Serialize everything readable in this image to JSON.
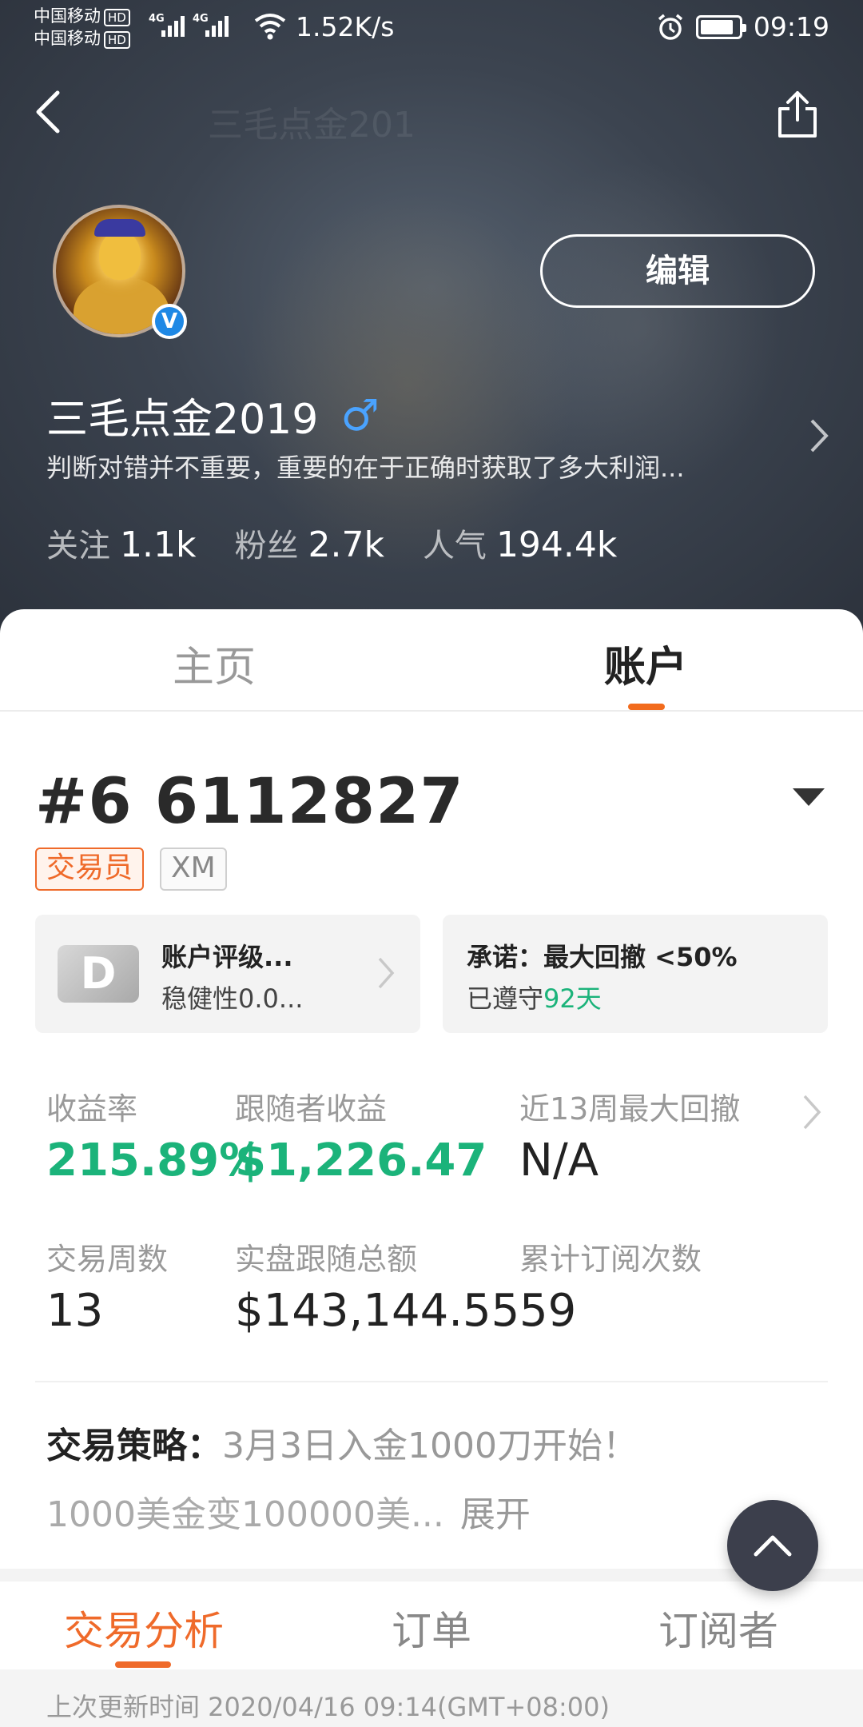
{
  "status_bar": {
    "carrier_1": "中国移动",
    "carrier_2": "中国移动",
    "hd_label": "HD",
    "network_type": "4G",
    "net_speed": "1.52K/s",
    "time": "09:19"
  },
  "header": {
    "faded_title": "三毛点金201"
  },
  "profile": {
    "name": "三毛点金2019",
    "gender_symbol": "♂",
    "verified_mark": "V",
    "edit_label": "编辑",
    "bio": "判断对错并不重要，重要的在于正确时获取了多大利润...",
    "stats": [
      {
        "label": "关注",
        "value": "1.1k"
      },
      {
        "label": "粉丝",
        "value": "2.7k"
      },
      {
        "label": "人气",
        "value": "194.4k"
      }
    ]
  },
  "tabs": {
    "home": "主页",
    "account": "账户"
  },
  "account": {
    "number": "#6 6112827",
    "tag_trader": "交易员",
    "tag_broker": "XM",
    "rating": {
      "grade": "D",
      "title": "账户评级...",
      "subtitle": "稳健性0.0..."
    },
    "promise": {
      "title": "承诺：最大回撤 <50%",
      "kept_prefix": "已遵守",
      "kept_days": "92天"
    }
  },
  "metrics": [
    {
      "label": "收益率",
      "value": "215.89%"
    },
    {
      "label": "跟随者收益",
      "value": "$1,226.47"
    },
    {
      "label": "近13周最大回撤",
      "value": "N/A"
    },
    {
      "label": "交易周数",
      "value": "13"
    },
    {
      "label": "实盘跟随总额",
      "value": "$143,144.55"
    },
    {
      "label": "累计订阅次数",
      "value": "59"
    }
  ],
  "strategy": {
    "label": "交易策略：",
    "line1": "3月3日入金1000刀开始！",
    "line2": "1000美金变100000美...",
    "expand": "展开"
  },
  "subtabs": {
    "analysis": "交易分析",
    "orders": "订单",
    "subscribers": "订阅者"
  },
  "footer": {
    "updated": "上次更新时间 2020/04/16 09:14(GMT+08:00)"
  },
  "colors": {
    "accent": "#ef6a2a",
    "positive": "#1bb37a",
    "verified": "#1e88e5"
  }
}
